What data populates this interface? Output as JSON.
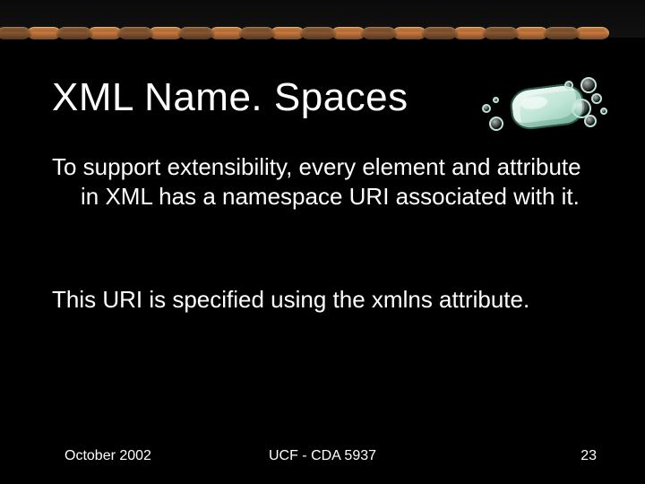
{
  "slide": {
    "title": "XML Name. Spaces",
    "paragraph1": "To support extensibility, every element and attribute in XML has a namespace URI associated with it.",
    "paragraph2": "This URI is specified using the xmlns attribute."
  },
  "footer": {
    "date": "October 2002",
    "course": "UCF - CDA 5937",
    "page": "23"
  },
  "decor": {
    "soap_icon": "soap-icon"
  }
}
